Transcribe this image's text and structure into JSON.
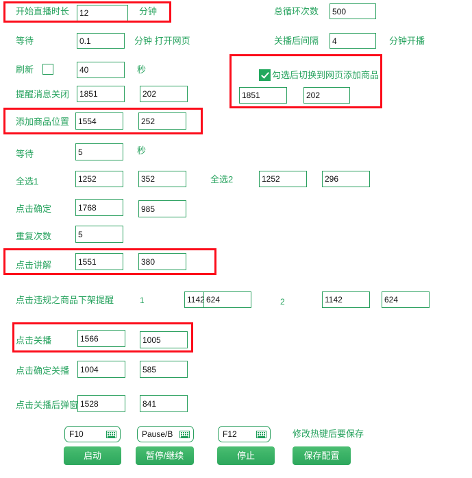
{
  "theme": {
    "label_color": "#28a35f",
    "field_border": "#2ba05f",
    "highlight_box": "#fc0d1b",
    "button_green": "#3bb367",
    "checkbox_checked": "#22a85e"
  },
  "rows": {
    "live_duration": {
      "label": "开始直播时长",
      "value": "12",
      "unit": "分钟"
    },
    "total_loops": {
      "label": "总循环次数",
      "value": "500"
    },
    "wait_open_page": {
      "label": "等待",
      "value": "0.1",
      "unit": "分钟 打开网页"
    },
    "close_interval": {
      "label": "关播后间隔",
      "value": "4",
      "unit": "分钟开播"
    },
    "refresh": {
      "label": "刷新",
      "checked": false,
      "value": "40",
      "unit": "秒"
    },
    "switch_page_add_goods": {
      "label": "勾选后切换到网页添加商品",
      "checked": true,
      "x": "1851",
      "y": "202"
    },
    "remind_close": {
      "label": "提醒消息关闭",
      "x": "1851",
      "y": "202"
    },
    "add_goods_pos": {
      "label": "添加商品位置",
      "x": "1554",
      "y": "252"
    },
    "wait_seconds": {
      "label": "等待",
      "value": "5",
      "unit": "秒"
    },
    "select_all_1": {
      "label": "全选1",
      "x": "1252",
      "y": "352"
    },
    "select_all_2": {
      "label": "全选2",
      "x": "1252",
      "y": "296"
    },
    "click_confirm": {
      "label": "点击确定",
      "x": "1768",
      "y": "985"
    },
    "repeat_count": {
      "label": "重复次数",
      "value": "5"
    },
    "click_explain": {
      "label": "点击讲解",
      "x": "1551",
      "y": "380"
    },
    "violation_remind": {
      "label": "点击违规之商品下架提醒",
      "index_1": "1",
      "x1": "1142",
      "y1": "624",
      "index_2": "2",
      "x2": "1142",
      "y2": "624"
    },
    "click_close_live": {
      "label": "点击关播",
      "x": "1566",
      "y": "1005"
    },
    "click_confirm_close": {
      "label": "点击确定关播",
      "x": "1004",
      "y": "585"
    },
    "click_close_popup": {
      "label": "点击关播后弹窗",
      "x": "1528",
      "y": "841"
    }
  },
  "hotkeys": {
    "start": {
      "value": "F10",
      "icon": "keyboard-icon"
    },
    "pause": {
      "value": "Pause/B",
      "icon": "keyboard-icon"
    },
    "stop": {
      "value": "F12",
      "icon": "keyboard-icon"
    },
    "note": "修改热键后要保存"
  },
  "buttons": {
    "start": "启动",
    "pause": "暂停/继续",
    "stop": "停止",
    "save": "保存配置"
  }
}
